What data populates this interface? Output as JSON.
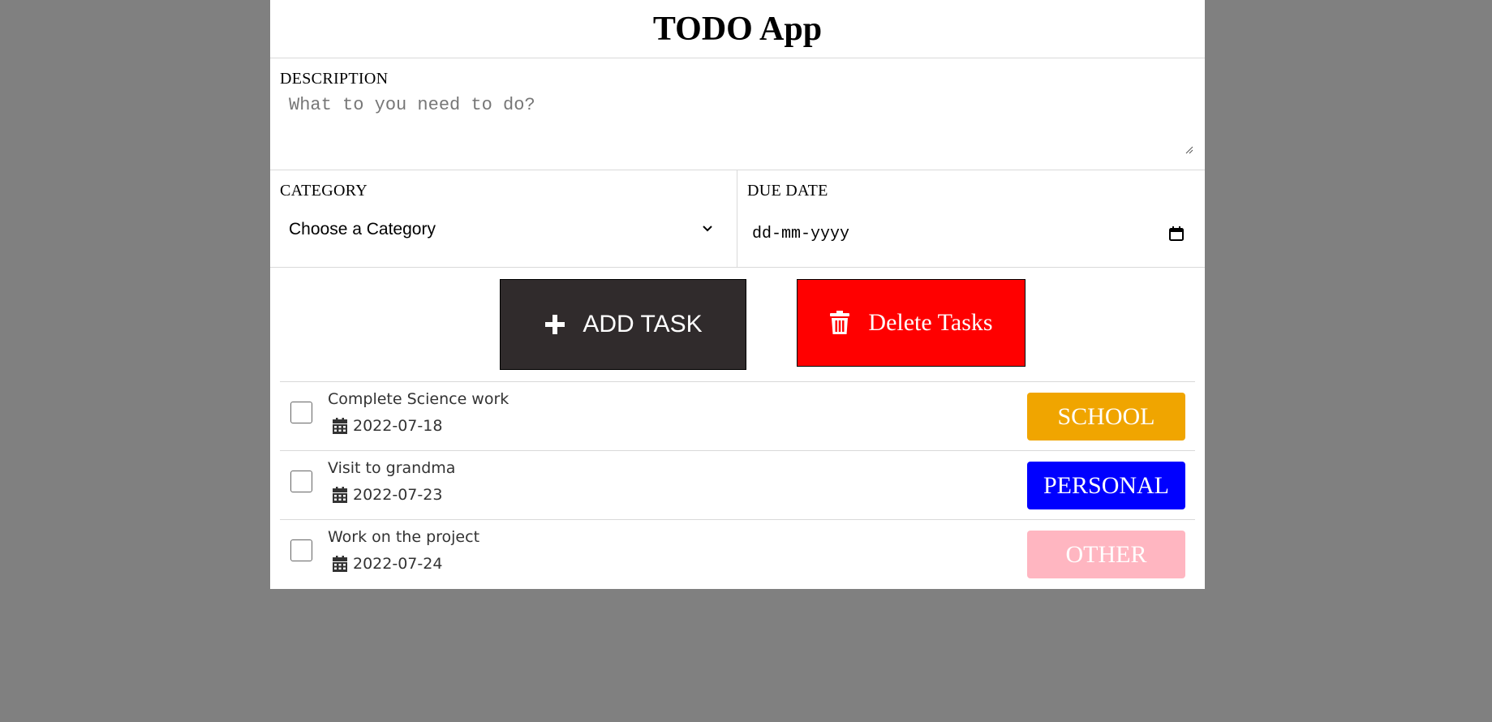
{
  "app": {
    "title": "TODO App"
  },
  "form": {
    "description_label": "DESCRIPTION",
    "description_placeholder": "What to you need to do?",
    "category_label": "CATEGORY",
    "category_value": "Choose a Category",
    "due_date_label": "DUE DATE",
    "due_date_placeholder": "dd-mm-yyyy"
  },
  "actions": {
    "add_label": "ADD TASK",
    "delete_label": "Delete Tasks",
    "add_icon": "plus-icon",
    "delete_icon": "trash-icon"
  },
  "tasks": [
    {
      "text": "Complete Science work",
      "date": "2022-07-18",
      "category": "SCHOOL",
      "color": "#f0a500",
      "checked": false
    },
    {
      "text": "Visit to grandma",
      "date": "2022-07-23",
      "category": "PERSONAL",
      "color": "#0000ff",
      "checked": false
    },
    {
      "text": "Work on the project",
      "date": "2022-07-24",
      "category": "OTHER",
      "color": "#ffb6c1",
      "checked": false
    }
  ],
  "colors": {
    "background": "#808080",
    "add_button": "#302b2c",
    "delete_button": "#ff0000"
  }
}
